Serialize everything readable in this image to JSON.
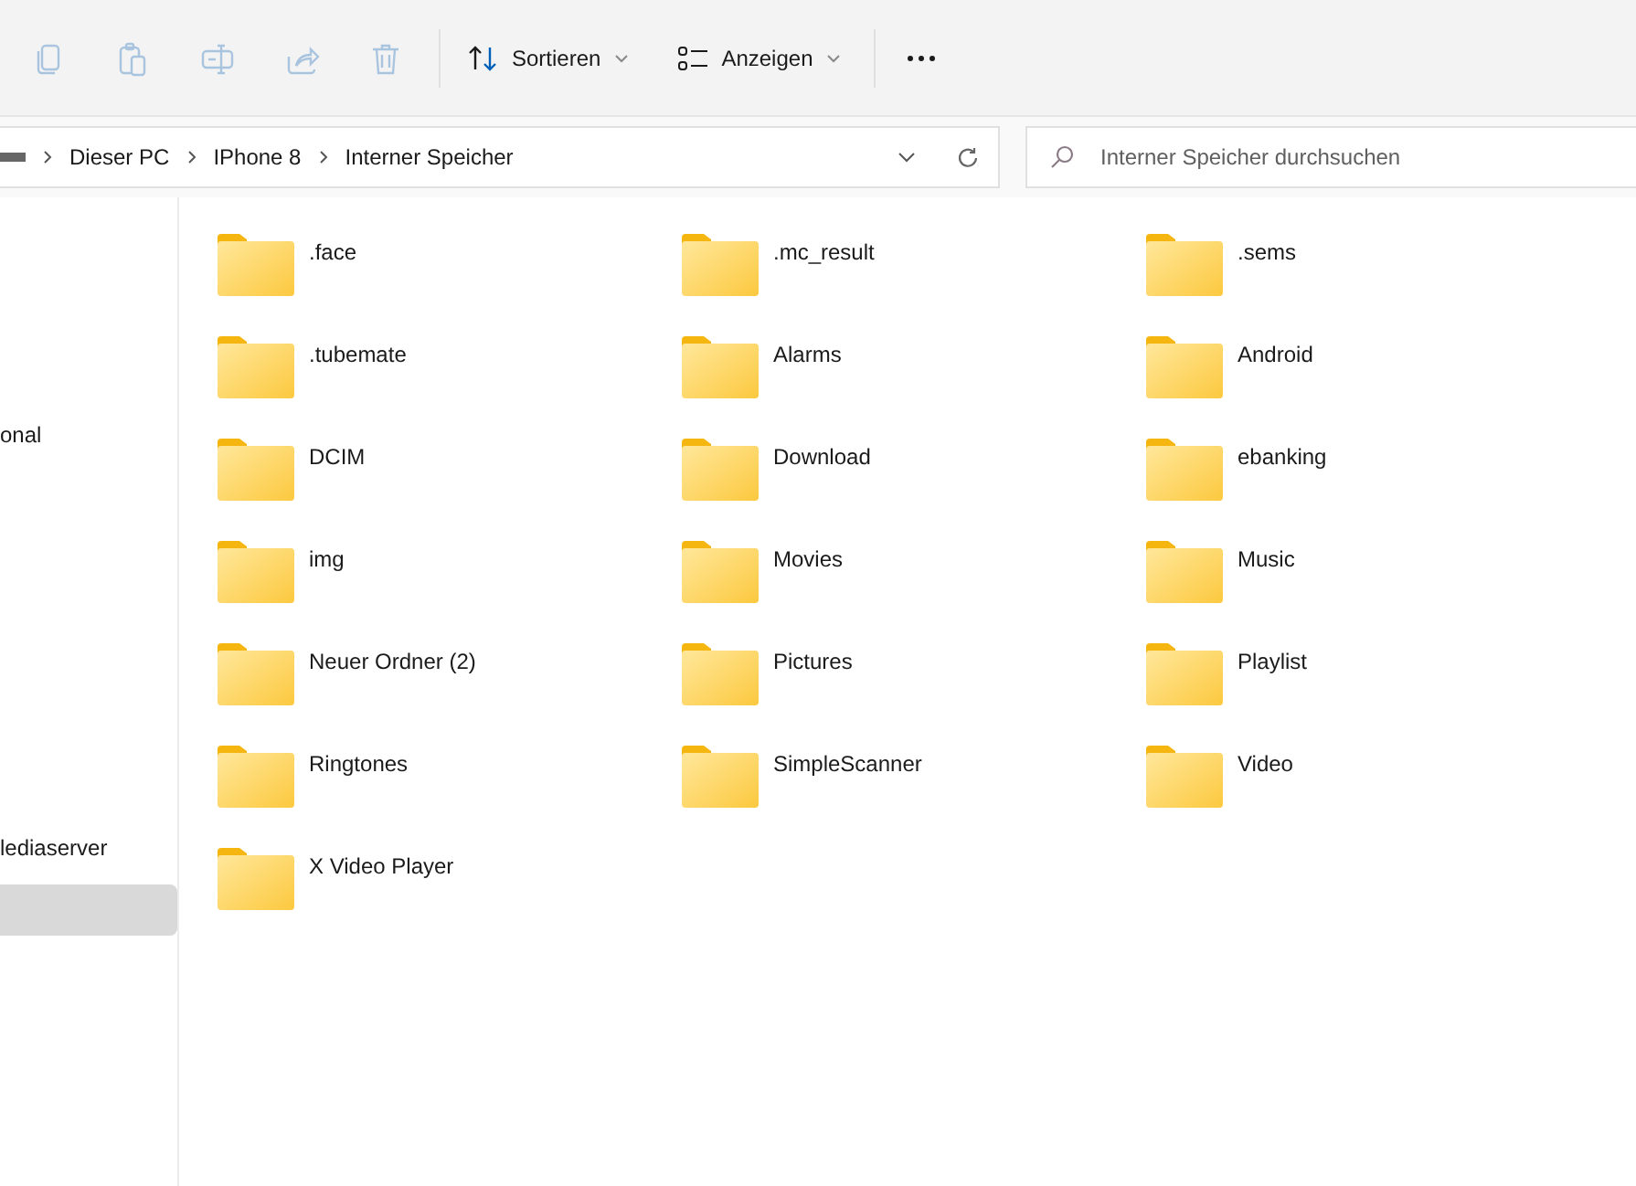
{
  "toolbar": {
    "actions": [
      {
        "kind": "copy",
        "disabled": true
      },
      {
        "kind": "paste",
        "disabled": true
      },
      {
        "kind": "rename",
        "disabled": true
      },
      {
        "kind": "share",
        "disabled": true
      },
      {
        "kind": "delete",
        "disabled": true
      }
    ],
    "menus": [
      {
        "kind": "sort",
        "label": "Sortieren"
      },
      {
        "kind": "view",
        "label": "Anzeigen"
      }
    ]
  },
  "address_bar": {
    "crumbs": [
      "Dieser PC",
      "IPhone 8",
      "Interner Speicher"
    ]
  },
  "search": {
    "placeholder": "Interner Speicher durchsuchen"
  },
  "sidebar": {
    "items": [
      {
        "label": "onal",
        "selected": false
      },
      {
        "label": "lediaserver",
        "selected": false
      },
      {
        "selected": true
      }
    ]
  },
  "folders": [
    ".face",
    ".mc_result",
    ".sems",
    ".tubemate",
    "Alarms",
    "Android",
    "DCIM",
    "Download",
    "ebanking",
    "img",
    "Movies",
    "Music",
    "Neuer Ordner (2)",
    "Pictures",
    "Playlist",
    "Ringtones",
    "SimpleScanner",
    "Video",
    "X Video Player"
  ]
}
